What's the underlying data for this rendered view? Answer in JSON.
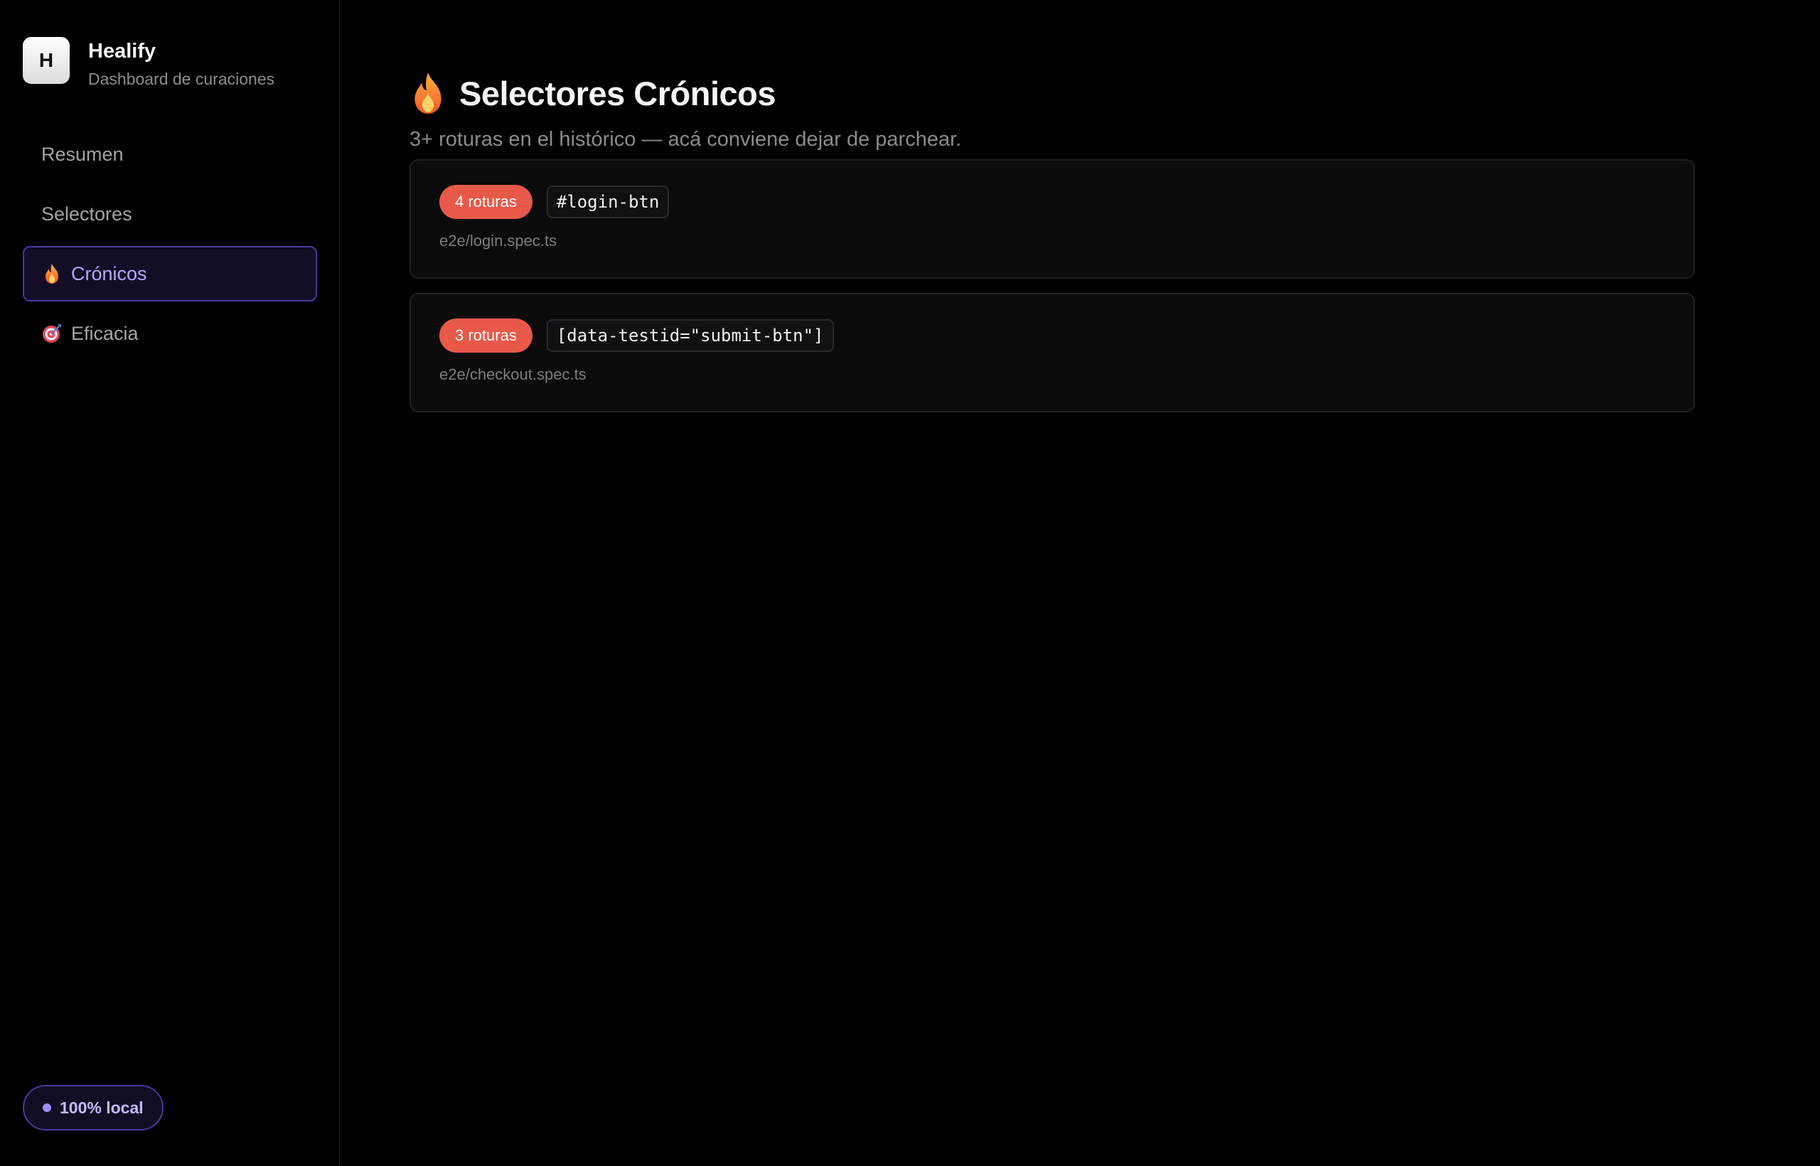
{
  "brand": {
    "logo_letter": "H",
    "name": "Healify",
    "subtitle": "Dashboard de curaciones"
  },
  "sidebar": {
    "items": [
      {
        "label": "Resumen",
        "icon": null,
        "active": false
      },
      {
        "label": "Selectores",
        "icon": null,
        "active": false
      },
      {
        "label": "Crónicos",
        "icon": "fire-icon",
        "active": true
      },
      {
        "label": "Eficacia",
        "icon": "target-icon",
        "active": false
      }
    ],
    "badge": "100% local"
  },
  "main": {
    "title_icon": "fire-icon",
    "title": "Selectores Crónicos",
    "subtitle": "3+ roturas en el histórico — acá conviene dejar de parchear.",
    "cards": [
      {
        "count_label": "4 roturas",
        "selector": "#login-btn",
        "file": "e2e/login.spec.ts"
      },
      {
        "count_label": "3 roturas",
        "selector": "[data-testid=\"submit-btn\"]",
        "file": "e2e/checkout.spec.ts"
      }
    ]
  },
  "colors": {
    "accent": "#a58cff",
    "active_bg": "#130e26",
    "active_border": "#4a38a0",
    "danger_pill": "#e8594a",
    "background": "#000000",
    "card_bg": "#0b0b0c"
  }
}
